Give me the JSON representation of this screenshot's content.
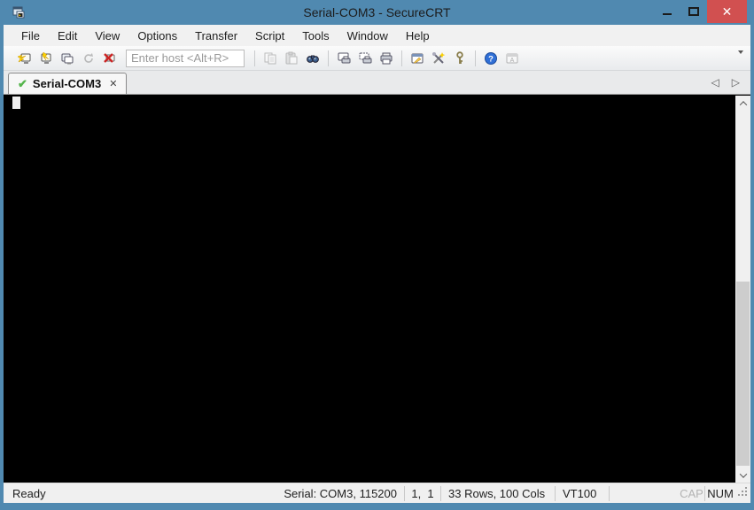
{
  "window": {
    "title": "Serial-COM3 - SecureCRT",
    "close_glyph": "✕"
  },
  "menu": {
    "items": [
      "File",
      "Edit",
      "View",
      "Options",
      "Transfer",
      "Script",
      "Tools",
      "Window",
      "Help"
    ]
  },
  "toolbar": {
    "host_placeholder": "Enter host <Alt+R>",
    "icons": [
      "quick-connect-icon",
      "connect-icon",
      "clone-session-icon",
      "reconnect-icon",
      "disconnect-icon",
      "copy-icon",
      "paste-icon",
      "find-icon",
      "print-screen-icon",
      "print-selection-icon",
      "print-icon",
      "session-options-icon",
      "global-options-icon",
      "key-generator-icon",
      "help-icon",
      "auto-complete-icon",
      "toolbar-overflow-icon"
    ]
  },
  "tabbar": {
    "active_tab": {
      "label": "Serial-COM3",
      "status_icon": "connected-check-icon",
      "close_glyph": "✕"
    },
    "scroll_left_glyph": "◁",
    "scroll_right_glyph": "▷"
  },
  "statusbar": {
    "ready": "Ready",
    "connection": "Serial: COM3, 115200",
    "cursor_position": "1,  1",
    "terminal_size": "33 Rows, 100 Cols",
    "emulation": "VT100",
    "caps_lock": "CAP",
    "num_lock": "NUM"
  },
  "colors": {
    "titlebar": "#5089b0",
    "close_button": "#d15050",
    "terminal_background": "#000000",
    "tab_check_green": "#55b54c",
    "help_blue": "#2f6fd6"
  }
}
